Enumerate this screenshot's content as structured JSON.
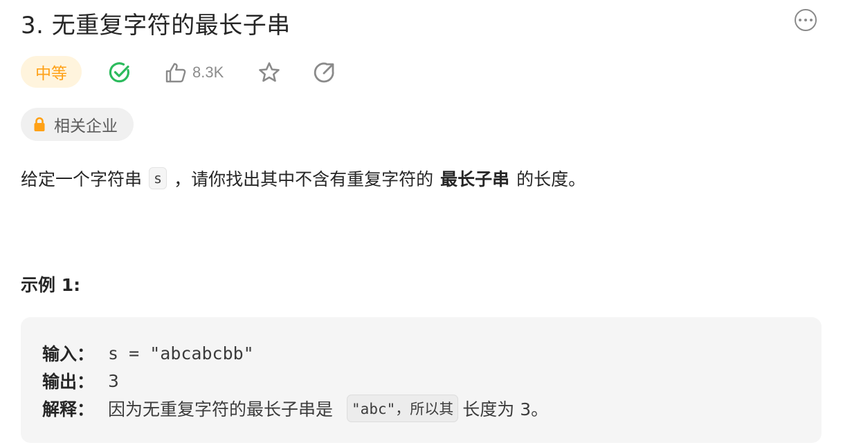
{
  "problem": {
    "title": "3. 无重复字符的最长子串"
  },
  "meta": {
    "difficulty": "中等",
    "difficulty_color": "#ffa116",
    "difficulty_bg": "#fff4dd",
    "solved_color": "#2cbb5d",
    "likes": "8.3K",
    "company_tag": "相关企业",
    "lock_color": "#ffa116"
  },
  "description": {
    "prefix": "给定一个字符串",
    "var": "s",
    "middle": "，请你找出其中不含有重复字符的",
    "emphasis": "最长子串",
    "suffix": "的长度。"
  },
  "example": {
    "title": "示例 1:",
    "input_label": "输入：",
    "input_value": "s = \"abcabcbb\"",
    "output_label": "输出：",
    "output_value": "3",
    "explain_label": "解释：",
    "explain_text": "因为无重复字符的最长子串是",
    "explain_code": "\"abc\"，所以其",
    "explain_suffix": "长度为 3。"
  },
  "icons": {
    "more": "more-horizontal-icon",
    "solved": "check-circle-icon",
    "like": "thumbs-up-icon",
    "favorite": "star-icon",
    "share": "share-icon",
    "lock": "lock-icon"
  }
}
